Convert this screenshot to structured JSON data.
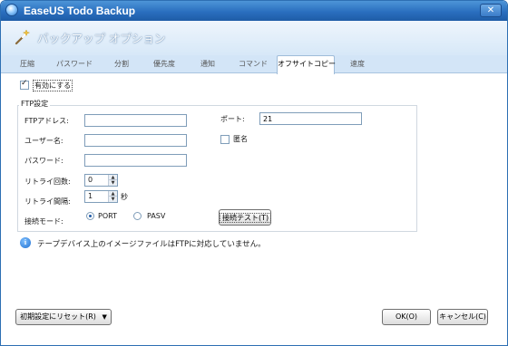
{
  "window": {
    "app_title": "EaseUS Todo Backup",
    "close_glyph": "✕"
  },
  "header": {
    "title": "バックアップ オプション",
    "icon": "magic-wand-icon"
  },
  "tabs": [
    {
      "label": "圧縮",
      "active": false
    },
    {
      "label": "パスワード",
      "active": false
    },
    {
      "label": "分割",
      "active": false
    },
    {
      "label": "優先度",
      "active": false
    },
    {
      "label": "通知",
      "active": false
    },
    {
      "label": "コマンド",
      "active": false
    },
    {
      "label": "オフサイトコピー",
      "active": true
    },
    {
      "label": "速度",
      "active": false
    }
  ],
  "enable": {
    "label": "有効にする",
    "checked": true
  },
  "ftp": {
    "legend": "FTP設定",
    "address_label": "FTPアドレス:",
    "address_value": "",
    "user_label": "ユーザー名:",
    "user_value": "",
    "password_label": "パスワード:",
    "password_value": "",
    "retry_count_label": "リトライ回数:",
    "retry_count_value": "0",
    "retry_interval_label": "リトライ間隔:",
    "retry_interval_value": "1",
    "seconds_unit": "秒",
    "mode_label": "接続モード:",
    "mode_options": [
      "PORT",
      "PASV"
    ],
    "mode_selected": "PORT",
    "port_label": "ポート:",
    "port_value": "21",
    "anonymous_label": "匿名",
    "anonymous_checked": false,
    "test_button": "接続テスト(T)"
  },
  "info": {
    "icon": "info-icon",
    "message": "テープデバイス上のイメージファイルはFTPに対応していません。"
  },
  "footer": {
    "reset_button": "初期設定にリセット(R)",
    "ok_button": "OK(O)",
    "cancel_button": "キャンセル(C)"
  }
}
